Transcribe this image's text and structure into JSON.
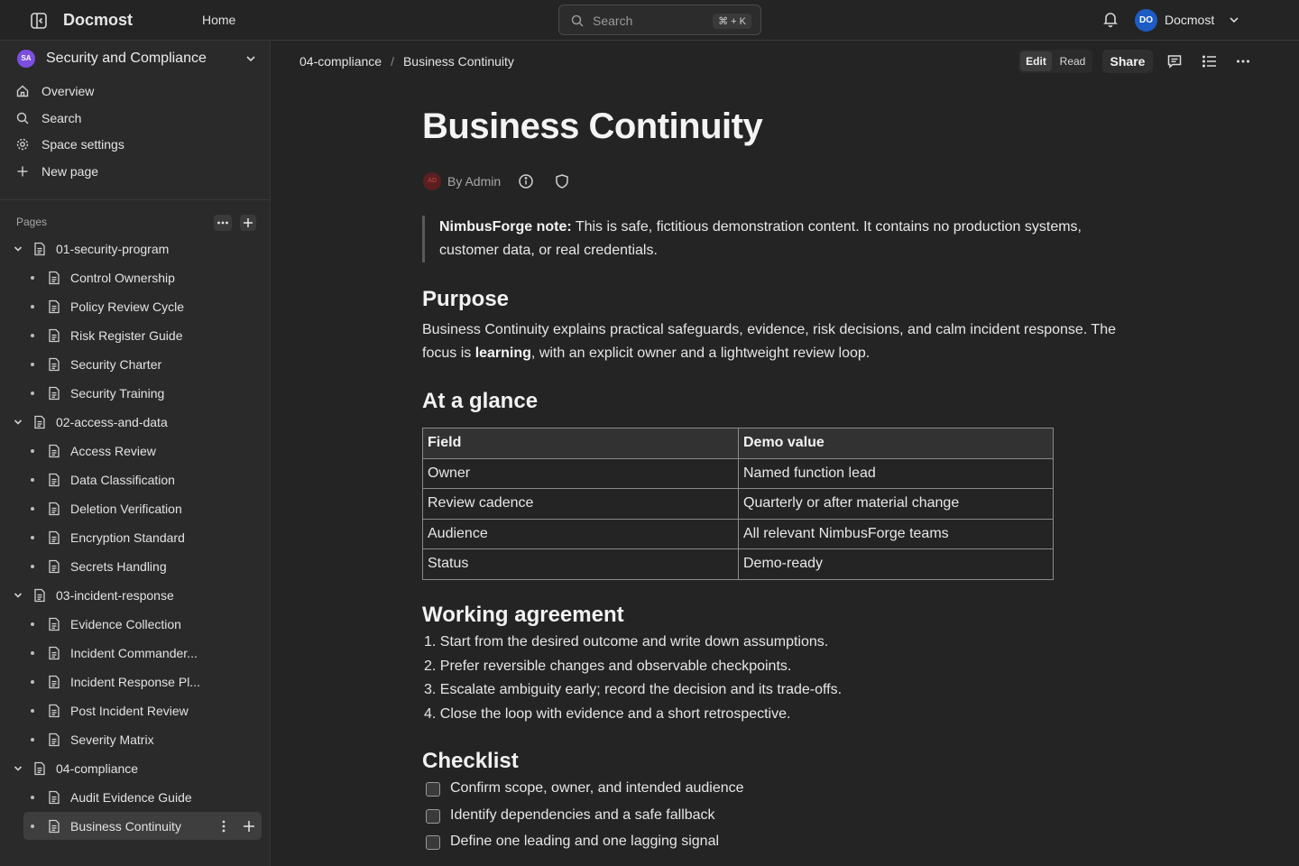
{
  "topbar": {
    "app_title": "Docmost",
    "home_label": "Home",
    "search_placeholder": "Search",
    "search_shortcut": "⌘ + K",
    "user_initials": "DO",
    "user_name": "Docmost"
  },
  "sidebar": {
    "space_initials": "SA",
    "space_name": "Security and Compliance",
    "nav": [
      {
        "label": "Overview",
        "icon": "home-icon"
      },
      {
        "label": "Search",
        "icon": "search-icon"
      },
      {
        "label": "Space settings",
        "icon": "gear-icon"
      },
      {
        "label": "New page",
        "icon": "plus-icon"
      }
    ],
    "pages_label": "Pages",
    "tree": [
      {
        "label": "01-security-program",
        "children": [
          "Control Ownership",
          "Policy Review Cycle",
          "Risk Register Guide",
          "Security Charter",
          "Security Training"
        ]
      },
      {
        "label": "02-access-and-data",
        "children": [
          "Access Review",
          "Data Classification",
          "Deletion Verification",
          "Encryption Standard",
          "Secrets Handling"
        ]
      },
      {
        "label": "03-incident-response",
        "children": [
          "Evidence Collection",
          "Incident Commander...",
          "Incident Response Pl...",
          "Post Incident Review",
          "Severity Matrix"
        ]
      },
      {
        "label": "04-compliance",
        "children": [
          "Audit Evidence Guide",
          "Business Continuity"
        ]
      }
    ],
    "active_page": "Business Continuity"
  },
  "header": {
    "breadcrumb": [
      "04-compliance",
      "Business Continuity"
    ],
    "mode_edit": "Edit",
    "mode_read": "Read",
    "share_label": "Share"
  },
  "document": {
    "title": "Business Continuity",
    "author_initials": "AD",
    "byline": "By Admin",
    "callout_bold": "NimbusForge note:",
    "callout_text": " This is safe, fictitious demonstration content. It contains no production systems, customer data, or real credentials.",
    "purpose_heading": "Purpose",
    "purpose_text_1": "Business Continuity explains practical safeguards, evidence, risk decisions, and calm incident response. The focus is ",
    "purpose_bold": "learning",
    "purpose_text_2": ", with an explicit owner and a lightweight review loop.",
    "glance_heading": "At a glance",
    "table_headers": [
      "Field",
      "Demo value"
    ],
    "table_rows": [
      [
        "Owner",
        "Named function lead"
      ],
      [
        "Review cadence",
        "Quarterly or after material change"
      ],
      [
        "Audience",
        "All relevant NimbusForge teams"
      ],
      [
        "Status",
        "Demo-ready"
      ]
    ],
    "agreement_heading": "Working agreement",
    "agreement_items": [
      "1. Start from the desired outcome and write down assumptions.",
      "2. Prefer reversible changes and observable checkpoints.",
      "3. Escalate ambiguity early; record the decision and its trade-offs.",
      "4. Close the loop with evidence and a short retrospective."
    ],
    "checklist_heading": "Checklist",
    "checklist_items": [
      "Confirm scope, owner, and intended audience",
      "Identify dependencies and a safe fallback",
      "Define one leading and one lagging signal"
    ]
  }
}
